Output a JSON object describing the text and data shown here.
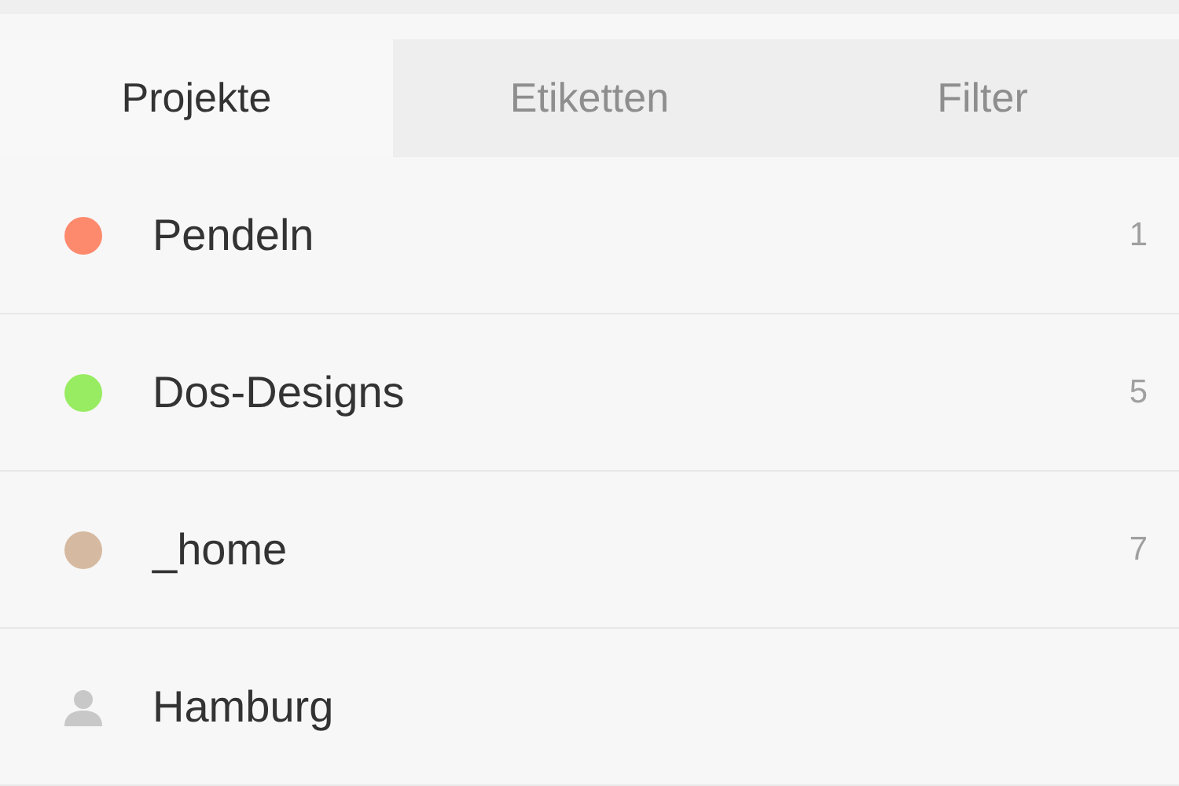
{
  "tabs": [
    {
      "label": "Projekte",
      "selected": true
    },
    {
      "label": "Etiketten",
      "selected": false
    },
    {
      "label": "Filter",
      "selected": false
    }
  ],
  "projects": [
    {
      "kind": "project",
      "name": "Pendeln",
      "color": "#fe8a6e",
      "count": "1"
    },
    {
      "kind": "project",
      "name": "Dos-Designs",
      "color": "#98ec62",
      "count": "5"
    },
    {
      "kind": "project",
      "name": "_home",
      "color": "#d6b9a1",
      "count": "7"
    },
    {
      "kind": "shared",
      "name": "Hamburg"
    }
  ]
}
